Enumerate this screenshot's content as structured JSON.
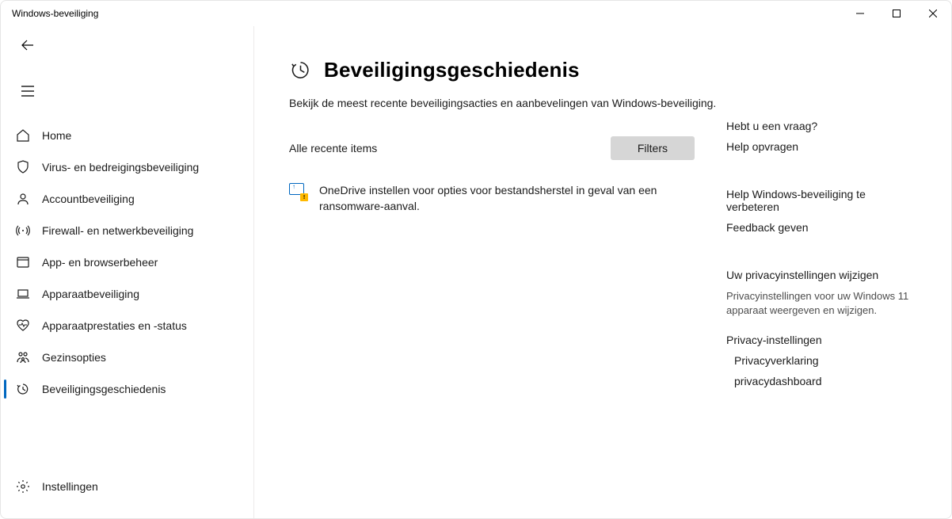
{
  "window": {
    "title": "Windows-beveiliging"
  },
  "nav": {
    "items": [
      {
        "label": "Home"
      },
      {
        "label": "Virus- en bedreigingsbeveiliging"
      },
      {
        "label": "Accountbeveiliging"
      },
      {
        "label": "Firewall- en netwerkbeveiliging"
      },
      {
        "label": "App- en browserbeheer"
      },
      {
        "label": "Apparaatbeveiliging"
      },
      {
        "label": "Apparaatprestaties en -status"
      },
      {
        "label": "Gezinsopties"
      },
      {
        "label": "Beveiligingsgeschiedenis"
      }
    ],
    "settings": "Instellingen"
  },
  "page": {
    "title": "Beveiligingsgeschiedenis",
    "subtitle": "Bekijk de meest recente beveiligingsacties en aanbevelingen van Windows-beveiliging.",
    "filter_label": "Alle recente items",
    "filters_btn": "Filters"
  },
  "history": {
    "items": [
      {
        "text": "OneDrive instellen voor opties voor bestandsherstel in geval van een ransomware-aanval."
      }
    ]
  },
  "side": {
    "q_heading": "Hebt u een vraag?",
    "q_link": "Help opvragen",
    "fb_heading": "Help Windows-beveiliging te verbeteren",
    "fb_link": "Feedback geven",
    "priv_heading": "Uw privacyinstellingen wijzigen",
    "priv_desc": "Privacyinstellingen voor uw Windows 11 apparaat weergeven en wijzigen.",
    "priv_link1": "Privacy-instellingen",
    "priv_link2": "Privacyverklaring",
    "priv_link3": "privacydashboard"
  }
}
